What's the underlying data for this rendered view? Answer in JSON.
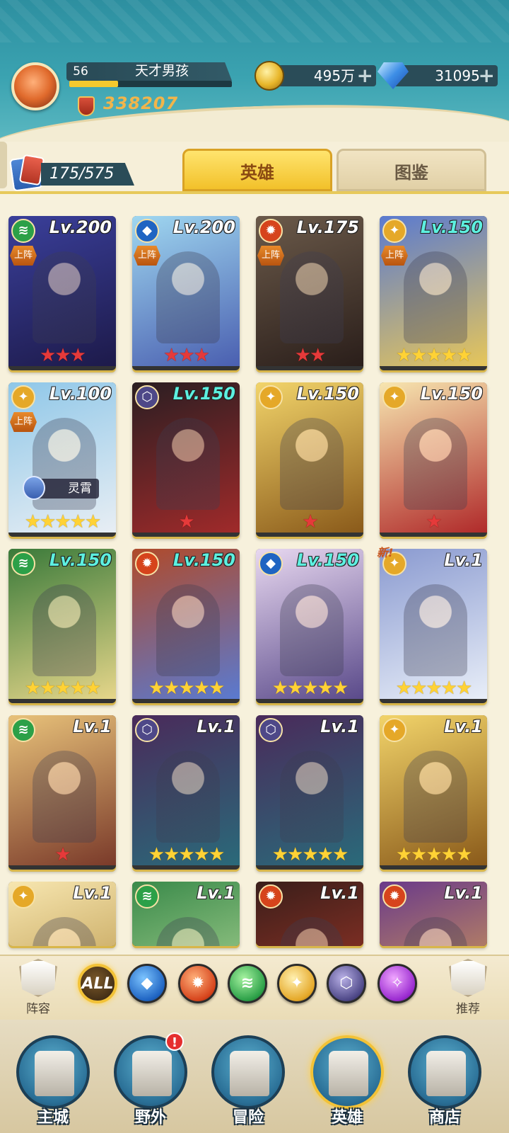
{
  "player": {
    "level": "56",
    "name": "天才男孩",
    "power": "338207",
    "xp_fraction": 0.3
  },
  "resources": {
    "gold": "495万",
    "diamonds": "31095"
  },
  "collection": {
    "count": "175/575"
  },
  "tabs": {
    "heroes": "英雄",
    "codex": "图鉴"
  },
  "heroes": [
    {
      "level": "Lv.200",
      "level_color": "white",
      "faction": "wind",
      "badge": "上阵",
      "stars": 3,
      "star_color": "red",
      "tag": "",
      "new": ""
    },
    {
      "level": "Lv.200",
      "level_color": "white",
      "faction": "water",
      "badge": "上阵",
      "stars": 3,
      "star_color": "red",
      "tag": "",
      "new": ""
    },
    {
      "level": "Lv.175",
      "level_color": "white",
      "faction": "fire",
      "badge": "上阵",
      "stars": 2,
      "star_color": "red",
      "tag": "",
      "new": ""
    },
    {
      "level": "Lv.150",
      "level_color": "cyan",
      "faction": "light",
      "badge": "上阵",
      "stars": 5,
      "star_color": "gold",
      "tag": "",
      "new": ""
    },
    {
      "level": "Lv.100",
      "level_color": "white",
      "faction": "light",
      "badge": "上阵",
      "stars": 5,
      "star_color": "gold",
      "tag": "灵霄",
      "new": ""
    },
    {
      "level": "Lv.150",
      "level_color": "cyan",
      "faction": "dark",
      "badge": "",
      "stars": 1,
      "star_color": "red",
      "tag": "",
      "new": ""
    },
    {
      "level": "Lv.150",
      "level_color": "white",
      "faction": "light",
      "badge": "",
      "stars": 1,
      "star_color": "red",
      "tag": "",
      "new": ""
    },
    {
      "level": "Lv.150",
      "level_color": "white",
      "faction": "light",
      "badge": "",
      "stars": 1,
      "star_color": "red",
      "tag": "",
      "new": ""
    },
    {
      "level": "Lv.150",
      "level_color": "cyan",
      "faction": "wind",
      "badge": "",
      "stars": 5,
      "star_color": "gold",
      "tag": "",
      "new": ""
    },
    {
      "level": "Lv.150",
      "level_color": "cyan",
      "faction": "fire",
      "badge": "",
      "stars": 5,
      "star_color": "gold",
      "tag": "",
      "new": ""
    },
    {
      "level": "Lv.150",
      "level_color": "cyan",
      "faction": "water",
      "badge": "",
      "stars": 5,
      "star_color": "gold",
      "tag": "",
      "new": ""
    },
    {
      "level": "Lv.1",
      "level_color": "white",
      "faction": "light",
      "badge": "",
      "stars": 5,
      "star_color": "gold",
      "tag": "",
      "new": "新!"
    },
    {
      "level": "Lv.1",
      "level_color": "white",
      "faction": "wind",
      "badge": "",
      "stars": 1,
      "star_color": "red",
      "tag": "",
      "new": ""
    },
    {
      "level": "Lv.1",
      "level_color": "white",
      "faction": "dark",
      "badge": "",
      "stars": 5,
      "star_color": "gold",
      "tag": "",
      "new": ""
    },
    {
      "level": "Lv.1",
      "level_color": "white",
      "faction": "dark",
      "badge": "",
      "stars": 5,
      "star_color": "gold",
      "tag": "",
      "new": ""
    },
    {
      "level": "Lv.1",
      "level_color": "white",
      "faction": "light",
      "badge": "",
      "stars": 5,
      "star_color": "gold",
      "tag": "",
      "new": ""
    },
    {
      "level": "Lv.1",
      "level_color": "white",
      "faction": "light",
      "badge": "",
      "stars": 0,
      "star_color": "gold",
      "tag": "",
      "new": ""
    },
    {
      "level": "Lv.1",
      "level_color": "white",
      "faction": "wind",
      "badge": "",
      "stars": 0,
      "star_color": "gold",
      "tag": "",
      "new": ""
    },
    {
      "level": "Lv.1",
      "level_color": "white",
      "faction": "fire",
      "badge": "",
      "stars": 0,
      "star_color": "gold",
      "tag": "",
      "new": ""
    },
    {
      "level": "Lv.1",
      "level_color": "white",
      "faction": "fire",
      "badge": "",
      "stars": 0,
      "star_color": "gold",
      "tag": "",
      "new": ""
    }
  ],
  "filters": {
    "left_label": "阵容",
    "right_label": "推荐",
    "all_label": "ALL",
    "factions": [
      "water",
      "fire",
      "wind",
      "light",
      "dark",
      "void"
    ]
  },
  "nav": [
    {
      "label": "主城",
      "alert": ""
    },
    {
      "label": "野外",
      "alert": "!"
    },
    {
      "label": "冒险",
      "alert": ""
    },
    {
      "label": "英雄",
      "alert": ""
    },
    {
      "label": "商店",
      "alert": ""
    }
  ],
  "colors": {
    "water": "#1f64c2",
    "fire": "#d6441c",
    "wind": "#2ca048",
    "light": "#e5a828",
    "dark": "#4e4888",
    "void": "#9a2ad0"
  }
}
